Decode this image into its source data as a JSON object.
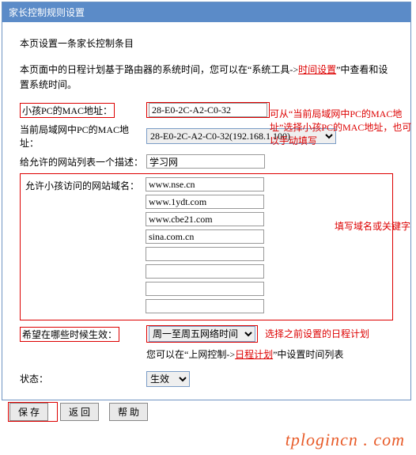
{
  "header": {
    "title": "家长控制规则设置"
  },
  "intro": {
    "title": "本页设置一条家长控制条目",
    "desc_pre": "本页面中的日程计划基于路由器的系统时间，您可以在“系统工具->",
    "desc_link": "时间设置",
    "desc_post": "”中查看和设置系统时间。"
  },
  "notes": {
    "mac_tip": "可从“当前局域网中PC的MAC地址”选择小孩PC的MAC地址，也可以手动填写",
    "domain_tip": "填写域名或关键字",
    "sched_tip": "选择之前设置的日程计划"
  },
  "fields": {
    "child_mac": {
      "label": "小孩PC的MAC地址：",
      "value": "28-E0-2C-A2-C0-32"
    },
    "lan_mac": {
      "label": "当前局域网中PC的MAC地址：",
      "value": "28-E0-2C-A2-C0-32(192.168.1.100)"
    },
    "desc": {
      "label": "给允许的网站列表一个描述：",
      "value": "学习网"
    },
    "domains": {
      "label": "允许小孩访问的网站域名：",
      "values": [
        "www.nse.cn",
        "www.1ydt.com",
        "www.cbe21.com",
        "sina.com.cn",
        "",
        "",
        "",
        ""
      ]
    },
    "schedule": {
      "label": "希望在哪些时候生效：",
      "value": "周一至周五网络时间"
    },
    "after_sched_pre": "您可以在“上网控制->",
    "after_sched_link": "日程计划",
    "after_sched_post": "”中设置时间列表",
    "status": {
      "label": "状态：",
      "value": "生效"
    }
  },
  "buttons": {
    "save": "保 存",
    "back": "返 回",
    "help": "帮 助"
  },
  "watermark": "tplogincn . com"
}
